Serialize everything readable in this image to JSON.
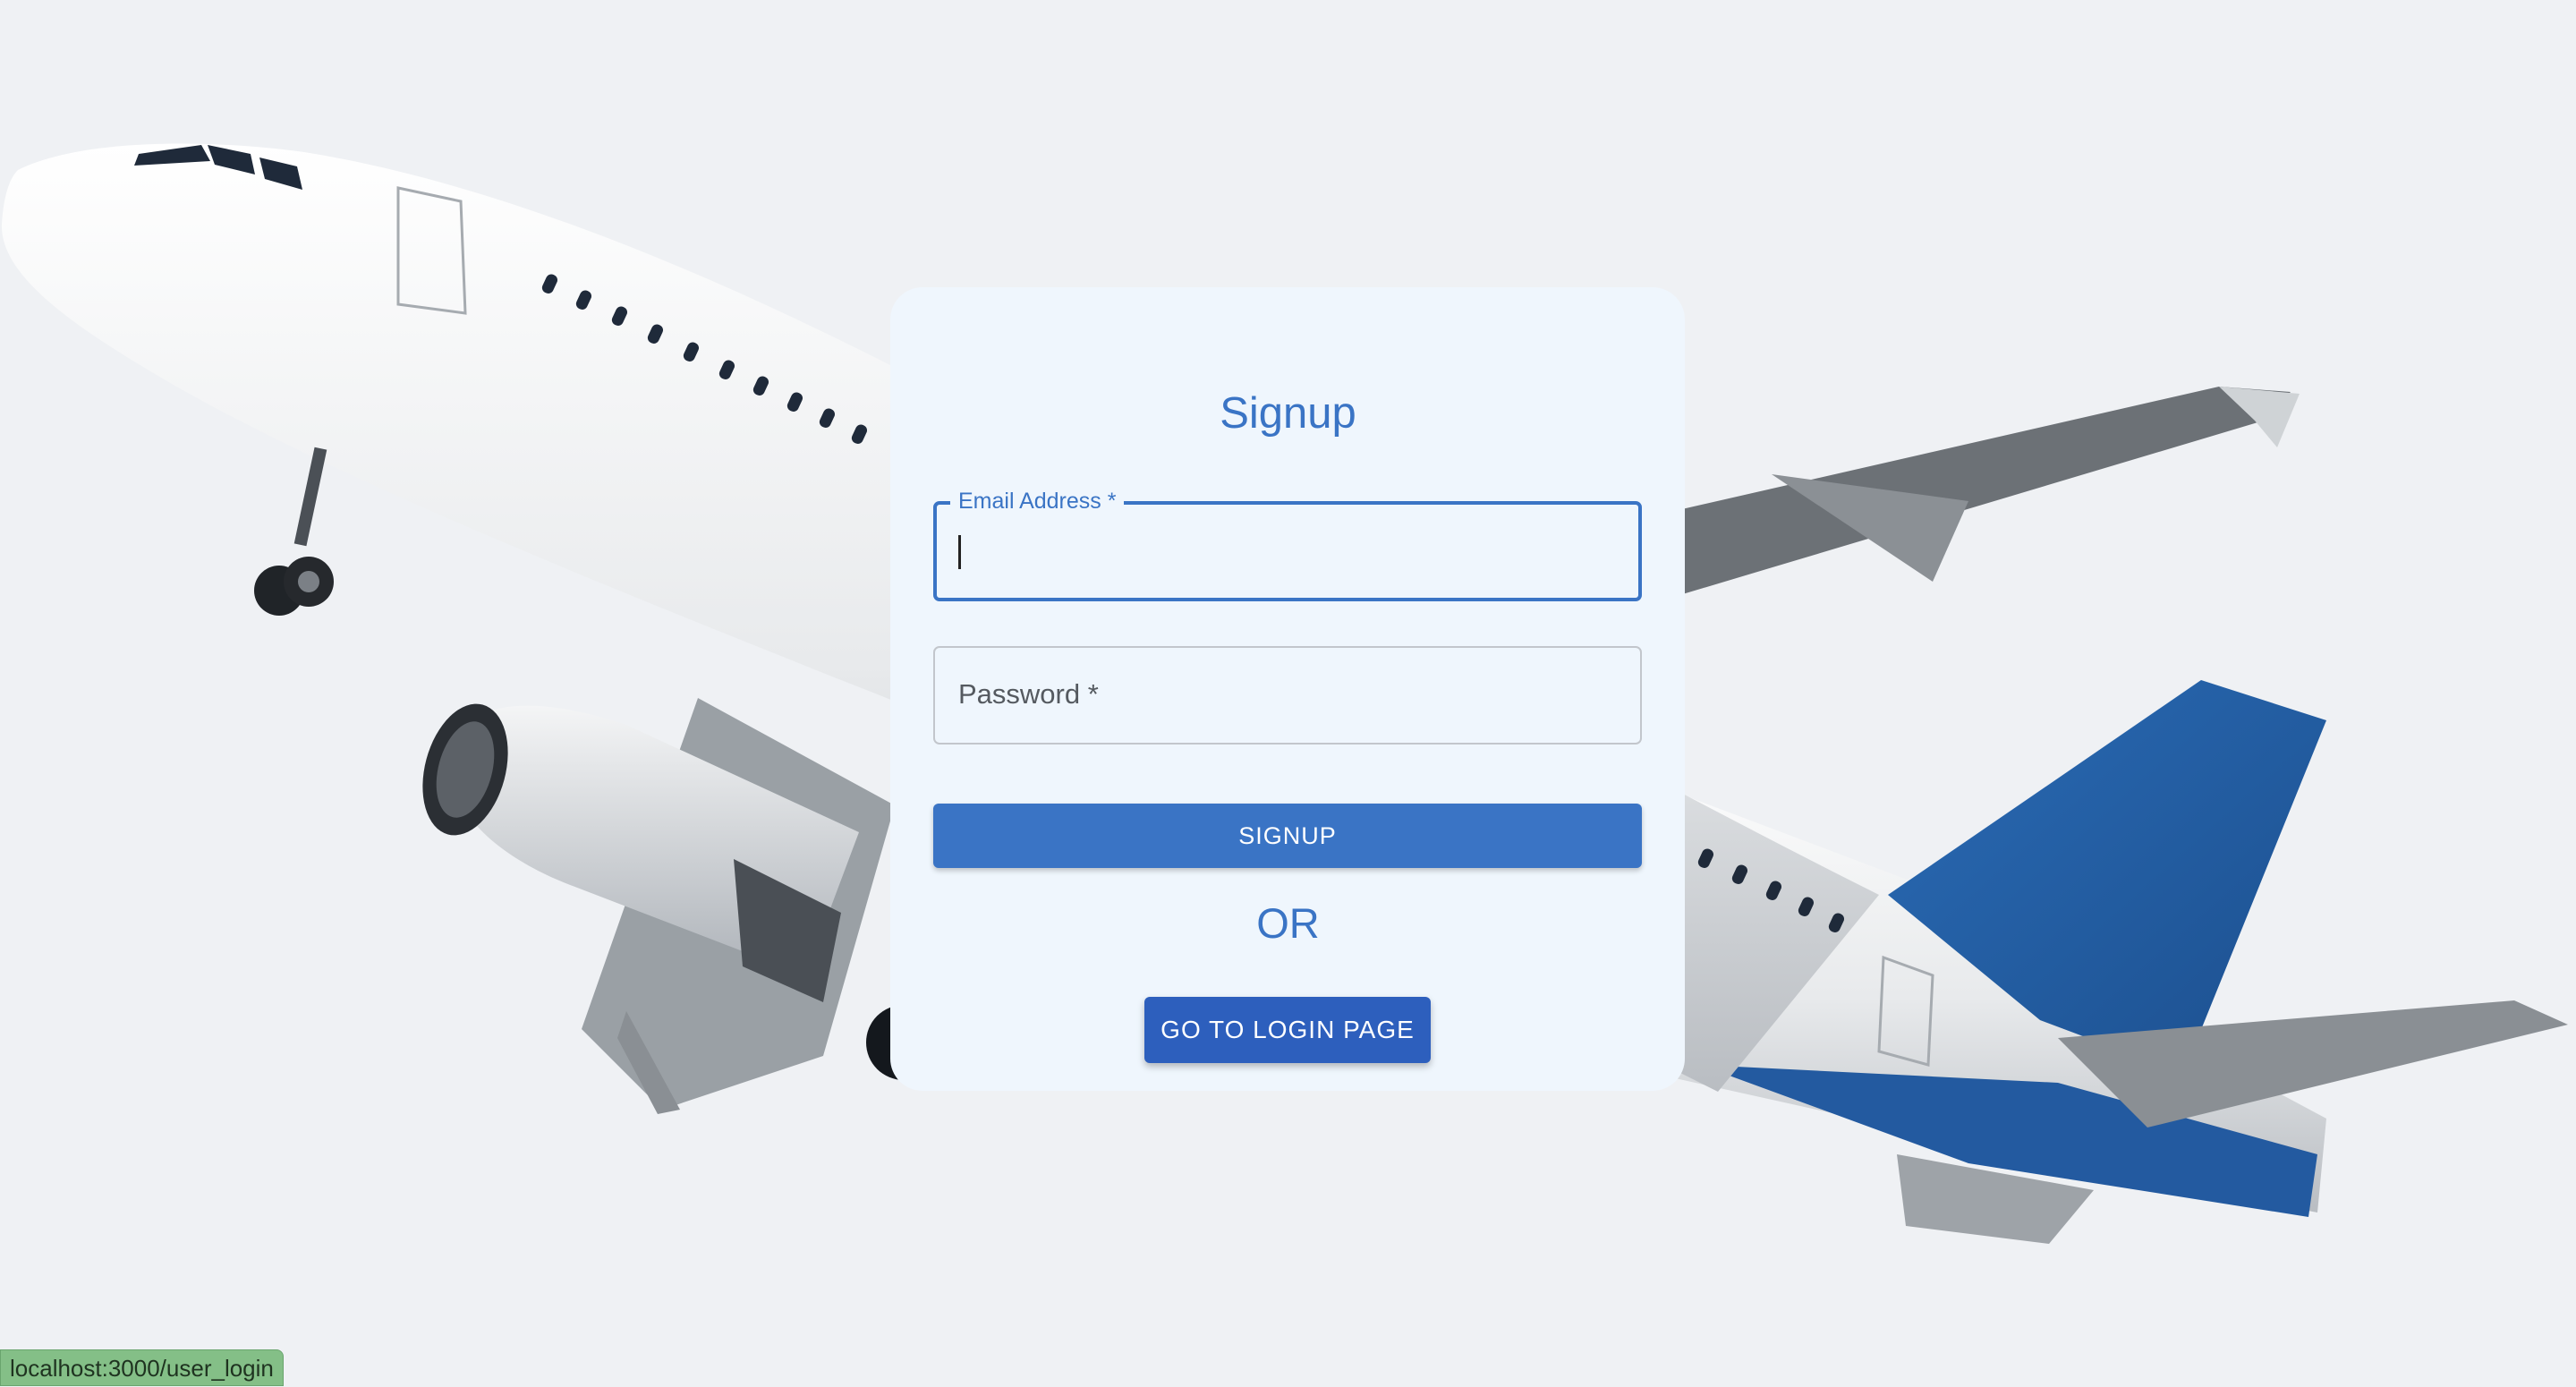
{
  "signup": {
    "title": "Signup",
    "email_label": "Email Address",
    "password_label": "Password",
    "required_mark": "*",
    "email_value": "",
    "password_value": "",
    "signup_button": "SIGNUP",
    "or_text": "OR",
    "login_button": "GO TO LOGIN PAGE"
  },
  "status_bar": {
    "url": "localhost:3000/user_login"
  },
  "colors": {
    "background": "#eff1f4",
    "card": "#eff6fd",
    "primary": "#3a74c5",
    "login_button": "#2d5fbd",
    "status_bar": "#84bf87"
  },
  "icons": {
    "background_image": "airplane"
  }
}
